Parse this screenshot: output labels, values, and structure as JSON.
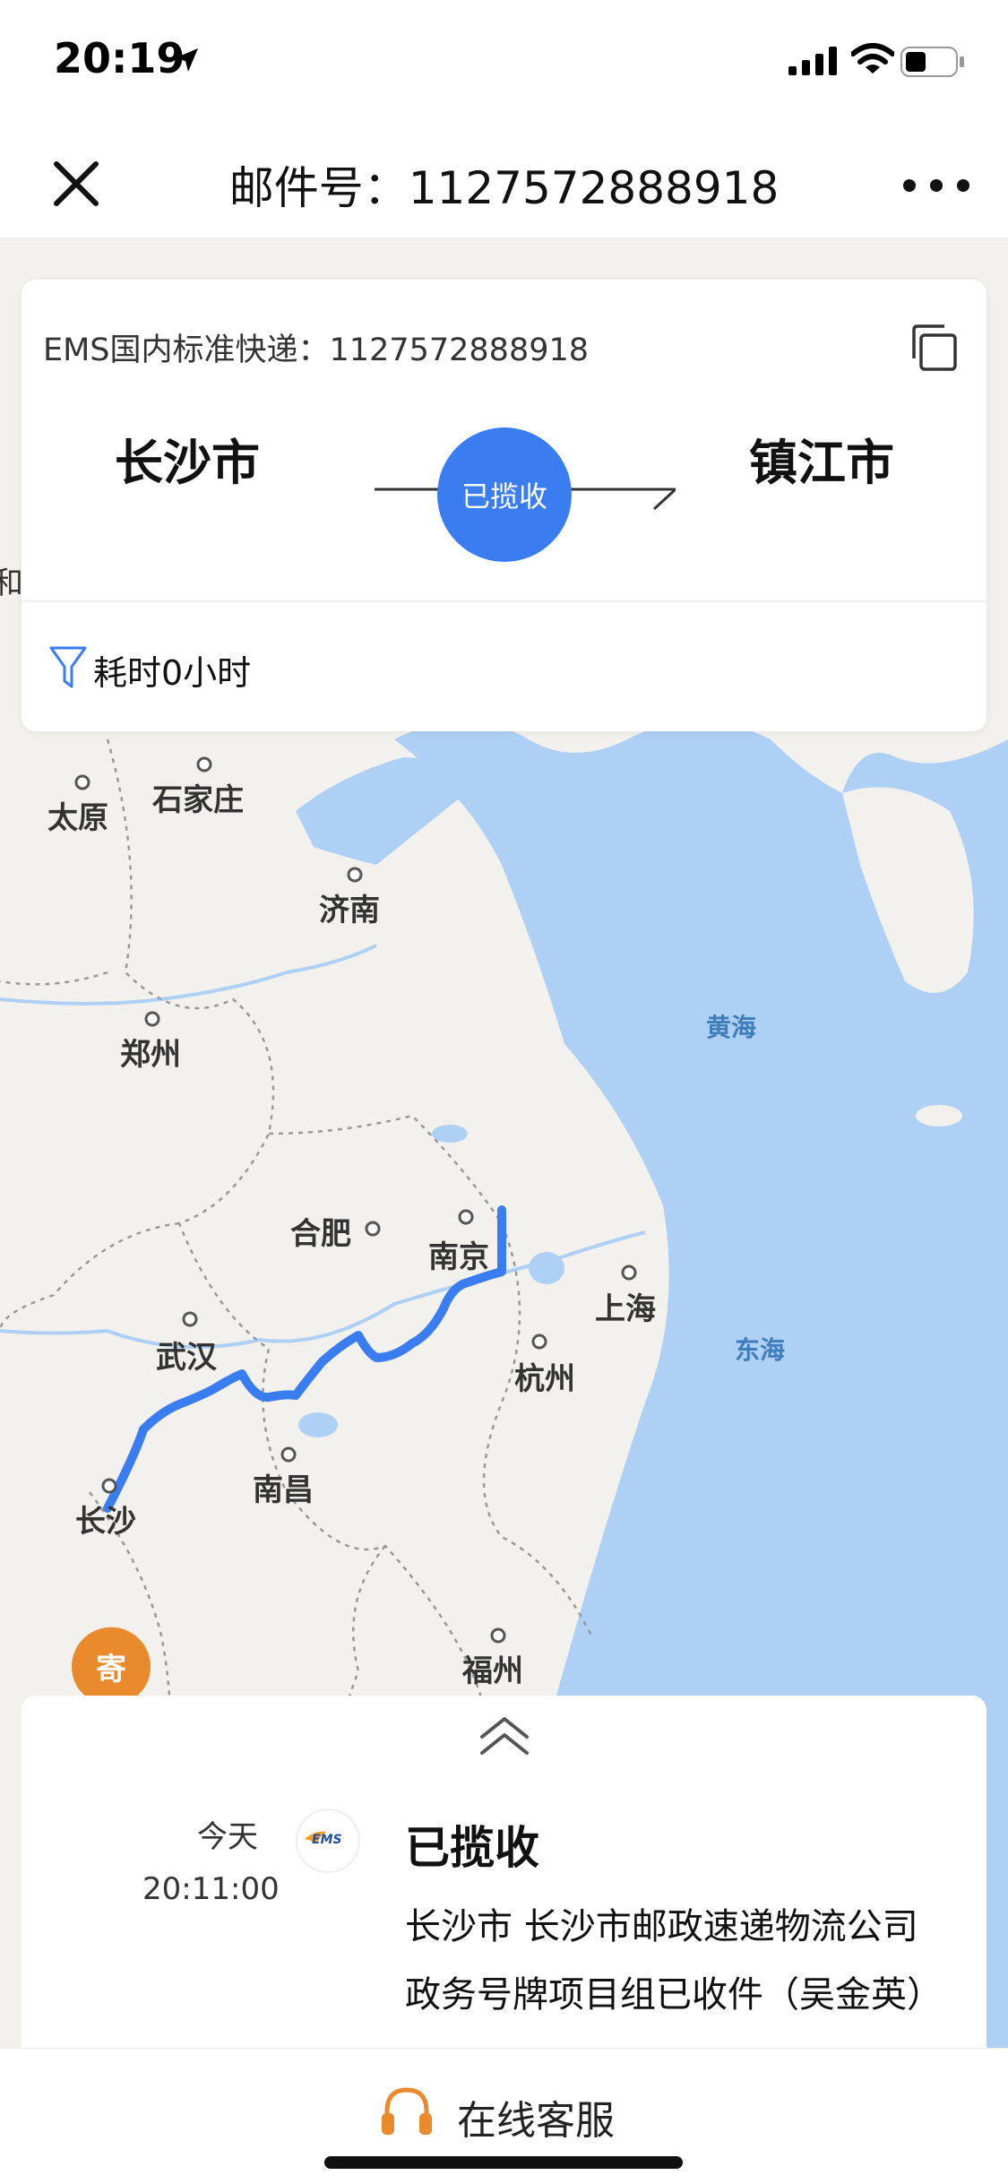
{
  "status_bar": {
    "time": "20:19"
  },
  "nav": {
    "title": "邮件号：1127572888918"
  },
  "card": {
    "courier": "EMS国内标准快递：1127572888918",
    "from_city": "长沙市",
    "to_city": "镇江市",
    "status": "已揽收",
    "duration": "耗时0小时"
  },
  "map": {
    "labels": [
      "太原",
      "石家庄",
      "济南",
      "郑州",
      "合肥",
      "南京",
      "上海",
      "武汉",
      "杭州",
      "南昌",
      "长沙",
      "福州"
    ],
    "sea_labels": [
      "黄海",
      "东海"
    ],
    "edge_label": "和",
    "origin_marker": "寄"
  },
  "timeline": {
    "day": "今天",
    "time": "20:11:00",
    "logo": "EMS",
    "title": "已揽收",
    "description": "长沙市 长沙市邮政速递物流公司政务号牌项目组已收件（吴金英）"
  },
  "bottom": {
    "service_label": "在线客服"
  },
  "colors": {
    "accent": "#3a7df0",
    "marker": "#e98a2c",
    "sea": "#aed0f4",
    "land": "#f2f1ee"
  }
}
